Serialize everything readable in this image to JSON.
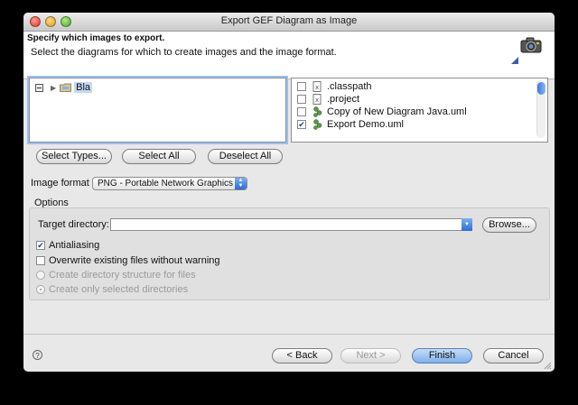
{
  "window": {
    "title": "Export GEF Diagram as Image"
  },
  "header": {
    "title": "Specify which images to export.",
    "description": "Select the diagrams for which to create images and the image format."
  },
  "tree": {
    "items": [
      {
        "label": "Bla"
      }
    ]
  },
  "files": {
    "items": [
      {
        "label": ".classpath",
        "checked": false
      },
      {
        "label": ".project",
        "checked": false
      },
      {
        "label": "Copy of New Diagram Java.uml",
        "checked": false
      },
      {
        "label": "Export Demo.uml",
        "checked": true
      }
    ]
  },
  "selection_buttons": {
    "select_types": "Select Types...",
    "select_all": "Select All",
    "deselect_all": "Deselect All"
  },
  "format": {
    "label": "Image format",
    "value": "PNG - Portable Network Graphics"
  },
  "options": {
    "group_label": "Options",
    "target_label": "Target directory:",
    "target_value": "",
    "browse": "Browse...",
    "antialiasing": "Antialiasing",
    "overwrite": "Overwrite existing files without warning",
    "create_structure": "Create directory structure for files",
    "create_selected": "Create only selected directories"
  },
  "footer": {
    "back": "< Back",
    "next": "Next >",
    "finish": "Finish",
    "cancel": "Cancel"
  },
  "icons": {
    "help": "?",
    "check": "✔"
  }
}
